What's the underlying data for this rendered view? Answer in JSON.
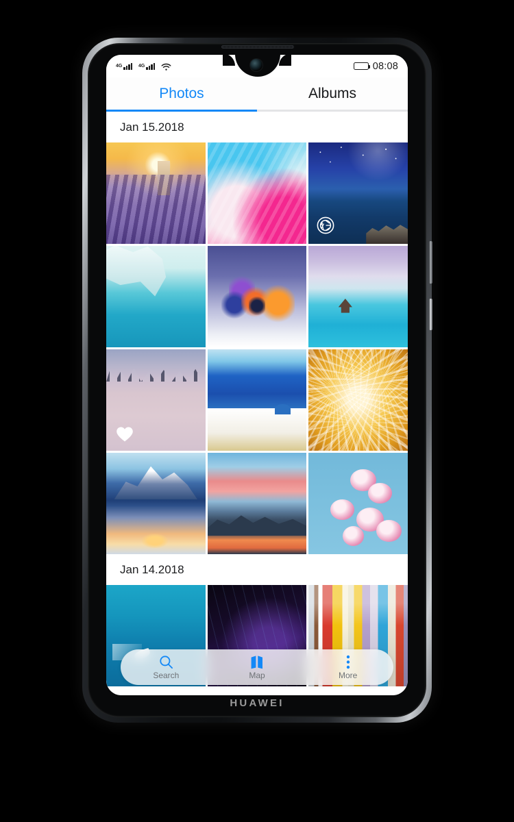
{
  "device": {
    "brand": "HUAWEI",
    "front_camera": "front-camera",
    "speaker": "earpiece-speaker"
  },
  "status_bar": {
    "signal_1": "4G",
    "signal_2": "4G",
    "wifi": "wifi-icon",
    "battery": "battery-icon",
    "time": "08:08"
  },
  "tabs": [
    {
      "label": "Photos",
      "active": true
    },
    {
      "label": "Albums",
      "active": false
    }
  ],
  "sections": [
    {
      "date": "Jan 15.2018",
      "tiles": [
        {
          "name": "lavender-field-sunset",
          "art": "art-lavender",
          "badge": null
        },
        {
          "name": "abstract-paint-pink-blue",
          "art": "art-paint",
          "badge": null
        },
        {
          "name": "starry-night-sea-village",
          "art": "art-starsea",
          "badge": "shutter-icon"
        },
        {
          "name": "iceberg-turquoise-water",
          "art": "art-iceberg",
          "badge": null
        },
        {
          "name": "color-powder-explosion",
          "art": "art-powder",
          "badge": null
        },
        {
          "name": "tropical-lagoon-hut",
          "art": "art-lagoon",
          "badge": null
        },
        {
          "name": "snow-field-trees",
          "art": "art-snow",
          "badge": "heart-icon"
        },
        {
          "name": "santorini-white-village",
          "art": "art-santorini",
          "badge": null
        },
        {
          "name": "golden-dandelion-seeds",
          "art": "art-dandelion",
          "badge": null
        },
        {
          "name": "mountain-lake-reflection",
          "art": "art-mountlake",
          "badge": null
        },
        {
          "name": "sunset-mountain-lake",
          "art": "art-sunsetmt",
          "badge": null
        },
        {
          "name": "pink-magnolia-blossoms",
          "art": "art-magnolia",
          "badge": null
        }
      ]
    },
    {
      "date": "Jan 14.2018",
      "tiles": [
        {
          "name": "turquoise-sea-boat",
          "art": "art-boatsea",
          "badge": null
        },
        {
          "name": "dark-purple-abstract",
          "art": "art-darkpurple",
          "badge": null
        },
        {
          "name": "colorful-abstract-painting",
          "art": "art-abstract",
          "badge": null
        }
      ]
    }
  ],
  "bottom_bar": [
    {
      "label": "Search",
      "icon": "search-icon"
    },
    {
      "label": "Map",
      "icon": "map-icon"
    },
    {
      "label": "More",
      "icon": "more-dots-icon"
    }
  ],
  "colors": {
    "accent": "#1388f7",
    "tab_inactive_text": "#17181a",
    "underline_inactive": "#e3e4e6",
    "bottom_label": "#6e7276"
  }
}
